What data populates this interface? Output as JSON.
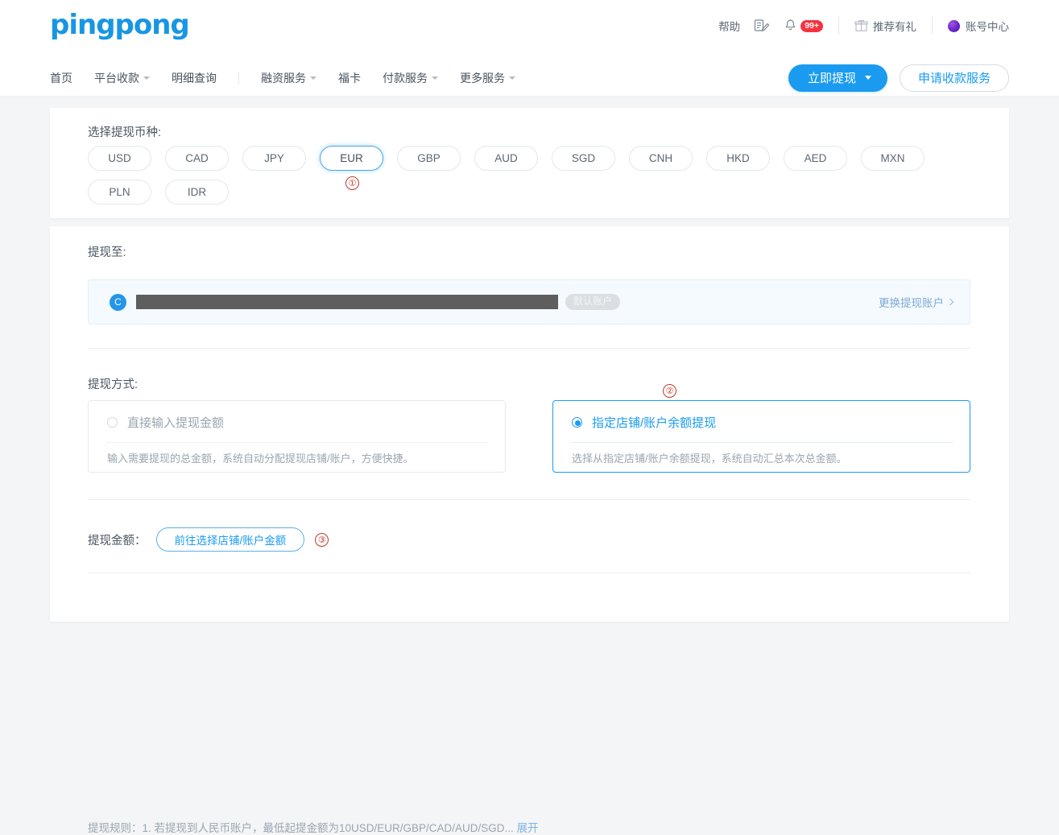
{
  "brand": {
    "logo_text": "pingpong",
    "accent": "#1a9bf0",
    "annotation_color": "#c0392b"
  },
  "header": {
    "help": "帮助",
    "form_icon": "form-edit-icon",
    "bell_icon": "bell-icon",
    "bell_badge": "99+",
    "referral_icon": "gift-icon",
    "referral": "推荐有礼",
    "account_icon": "globe-icon",
    "account_center": "账号中心"
  },
  "nav": {
    "items": [
      {
        "label": "首页",
        "caret": false
      },
      {
        "label": "平台收款",
        "caret": true
      },
      {
        "label": "明细查询",
        "caret": false
      },
      {
        "label": "融资服务",
        "caret": true
      },
      {
        "label": "福卡",
        "caret": false
      },
      {
        "label": "付款服务",
        "caret": true
      },
      {
        "label": "更多服务",
        "caret": true
      }
    ],
    "withdraw_button": "立即提现",
    "apply_button": "申请收款服务"
  },
  "currency": {
    "label": "选择提现币种:",
    "selected": "EUR",
    "annotation": "①",
    "chips": [
      "USD",
      "CAD",
      "JPY",
      "EUR",
      "GBP",
      "AUD",
      "SGD",
      "CNH",
      "HKD",
      "AED",
      "MXN",
      "PLN",
      "IDR"
    ]
  },
  "withdraw_to": {
    "label": "提现至:",
    "avatar_letter": "C",
    "account_masked": "",
    "default_tag": "默认账户",
    "change_link": "更换提现账户",
    "chevron_icon": "chevron-right-icon"
  },
  "method": {
    "label": "提现方式:",
    "annotation": "②",
    "options": [
      {
        "title": "直接输入提现金额",
        "desc": "输入需要提现的总金额，系统自动分配提现店铺/账户，方便快捷。",
        "selected": false
      },
      {
        "title": "指定店铺/账户余额提现",
        "desc": "选择从指定店铺/账户余额提现，系统自动汇总本次总金额。",
        "selected": true
      }
    ]
  },
  "amount": {
    "label": "提现金额：",
    "goto_button": "前往选择店铺/账户金额",
    "annotation": "③"
  },
  "rules": {
    "text": "提现规则：1. 若提现到人民币账户，最低起提金额为10USD/EUR/GBP/CAD/AUD/SGD...",
    "expand": "展开"
  }
}
